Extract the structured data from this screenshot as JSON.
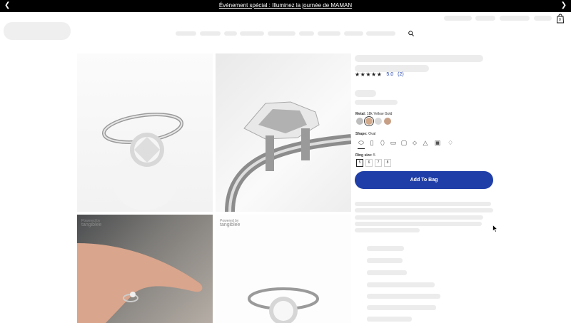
{
  "announcement": {
    "text": "Événement spécial : Illuminez la journée de MAMAN"
  },
  "header": {
    "cart_count": "0"
  },
  "product": {
    "rating": {
      "stars": "★★★★★",
      "score": "5.0",
      "count": "(2)"
    },
    "metal": {
      "label": "Metal:",
      "value": "18k Yellow Gold",
      "swatches": [
        "#bdbdbd",
        "#d2a98a",
        "#d9d9d9",
        "#c79f85"
      ]
    },
    "shape": {
      "label": "Shape:",
      "value": "Oval"
    },
    "ring_size": {
      "label": "Ring size:",
      "value": "5",
      "options": [
        "5",
        "6",
        "7",
        "8"
      ]
    },
    "add_to_bag": "Add To Bag"
  },
  "gallery": {
    "powered_by": "Powered by",
    "brand": "tangiblee"
  }
}
